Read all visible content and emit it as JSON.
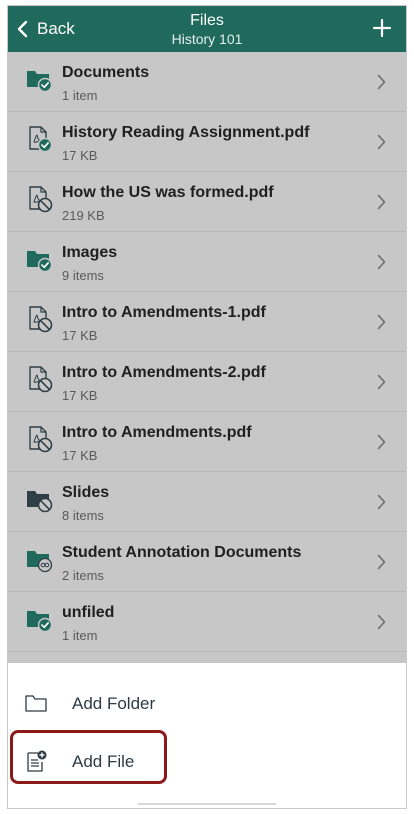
{
  "header": {
    "back_label": "Back",
    "title": "Files",
    "subtitle": "History 101",
    "add_icon": "plus-icon",
    "color": "#1f6a5c"
  },
  "files": [
    {
      "name": "Documents",
      "meta": "1 item",
      "type": "folder",
      "status": "published"
    },
    {
      "name": "History Reading Assignment.pdf",
      "meta": "17 KB",
      "type": "pdf",
      "status": "published"
    },
    {
      "name": "How the US was formed.pdf",
      "meta": "219 KB",
      "type": "pdf",
      "status": "unpublished"
    },
    {
      "name": "Images",
      "meta": "9 items",
      "type": "folder",
      "status": "published"
    },
    {
      "name": "Intro to Amendments-1.pdf",
      "meta": "17 KB",
      "type": "pdf",
      "status": "unpublished"
    },
    {
      "name": "Intro to Amendments-2.pdf",
      "meta": "17 KB",
      "type": "pdf",
      "status": "unpublished"
    },
    {
      "name": "Intro to Amendments.pdf",
      "meta": "17 KB",
      "type": "pdf",
      "status": "unpublished"
    },
    {
      "name": "Slides",
      "meta": "8 items",
      "type": "folder",
      "status": "unpublished"
    },
    {
      "name": "Student Annotation Documents",
      "meta": "2 items",
      "type": "folder",
      "status": "restricted"
    },
    {
      "name": "unfiled",
      "meta": "1 item",
      "type": "folder",
      "status": "published"
    }
  ],
  "sheet": {
    "add_folder_label": "Add Folder",
    "add_folder_icon": "folder-outline-icon",
    "add_file_label": "Add File",
    "add_file_icon": "add-file-icon"
  },
  "colors": {
    "accent": "#1f6a5c",
    "published": "#1f6a5c",
    "highlight": "#8b1a1a"
  }
}
